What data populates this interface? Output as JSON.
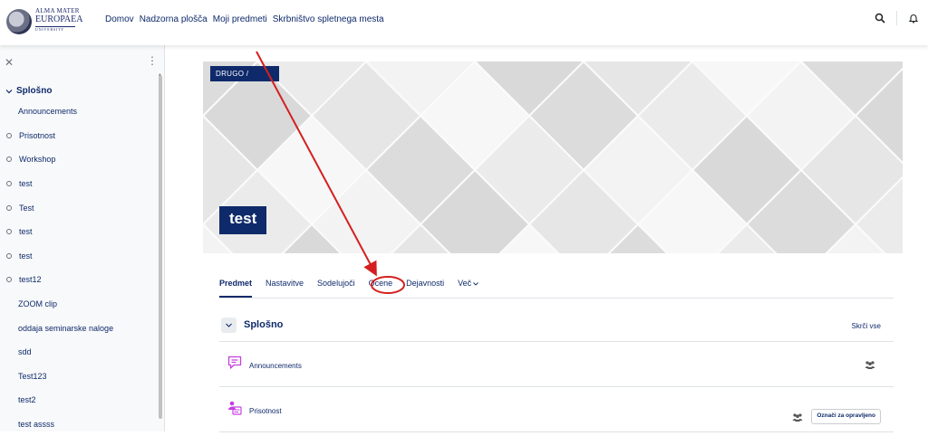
{
  "navbar": {
    "logo": {
      "line1": "ALMA MATER",
      "line2": "EUROPAEA",
      "line3": "UNIVERSITY"
    },
    "links": [
      "Domov",
      "Nadzorna plošča",
      "Moji predmeti",
      "Skrbništvo spletnega mesta"
    ],
    "icons": [
      "search-icon",
      "bell-icon"
    ]
  },
  "drawer": {
    "section": "Splošno",
    "items": [
      {
        "label": "Announcements",
        "circle": false
      },
      {
        "label": "Prisotnost",
        "circle": true
      },
      {
        "label": "Workshop",
        "circle": true
      },
      {
        "label": "test",
        "circle": true
      },
      {
        "label": "Test",
        "circle": true
      },
      {
        "label": "test",
        "circle": true
      },
      {
        "label": "test",
        "circle": true
      },
      {
        "label": "test12",
        "circle": true
      },
      {
        "label": "ZOOM clip",
        "circle": false
      },
      {
        "label": "oddaja seminarske naloge",
        "circle": false
      },
      {
        "label": "sdd",
        "circle": false
      },
      {
        "label": "Test123",
        "circle": false
      },
      {
        "label": "test2",
        "circle": false
      },
      {
        "label": "test assss",
        "circle": false
      }
    ]
  },
  "course": {
    "breadcrumb": "DRUGO /",
    "title": "test"
  },
  "tabs": [
    {
      "label": "Predmet",
      "active": true
    },
    {
      "label": "Nastavitve",
      "active": false
    },
    {
      "label": "Sodelujoči",
      "active": false
    },
    {
      "label": "Ocene",
      "active": false
    },
    {
      "label": "Dejavnosti",
      "active": false
    }
  ],
  "tab_more": "Več",
  "section": {
    "title": "Splošno",
    "collapse_all": "Skrči vse",
    "activities": [
      {
        "name": "Announcements",
        "icon": "forum-icon",
        "color": "#c63fe0"
      },
      {
        "name": "Prisotnost",
        "icon": "attendance-icon",
        "color": "#c63fe0",
        "action": "Označi za opravljeno"
      }
    ]
  },
  "colors": {
    "brand": "#0f2a6b",
    "annotation": "#d42020"
  }
}
